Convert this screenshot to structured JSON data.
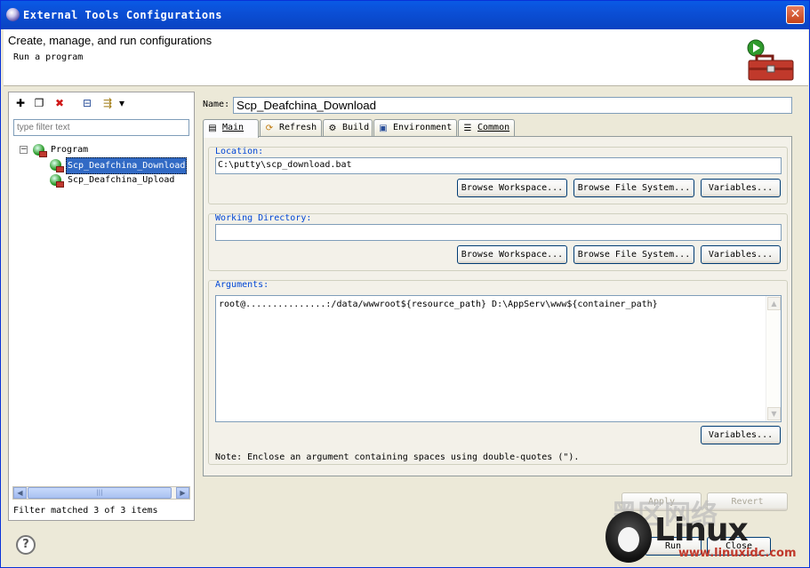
{
  "window": {
    "title": "External Tools Configurations",
    "close_label": "✕"
  },
  "header": {
    "title": "Create, manage, and run configurations",
    "subtitle": "Run a program"
  },
  "left": {
    "toolbar": [
      {
        "name": "new-configuration-icon",
        "glyph": "✚"
      },
      {
        "name": "duplicate-icon",
        "glyph": "❐"
      },
      {
        "name": "delete-icon",
        "glyph": "✖"
      },
      {
        "name": "collapse-all-icon",
        "glyph": "⊟"
      },
      {
        "name": "filter-icon",
        "glyph": "⇶"
      },
      {
        "name": "dropdown-arrow-icon",
        "glyph": "▾"
      }
    ],
    "filter_placeholder": "type filter text",
    "tree": {
      "category": "Program",
      "expander": "−",
      "items": [
        "Scp_Deafchina_Download",
        "Scp_Deafchina_Upload"
      ]
    },
    "scroll_left": "◀",
    "scroll_right": "▶",
    "scroll_grip": "|||",
    "status": "Filter matched 3 of 3 items"
  },
  "right": {
    "name_label": "Name:",
    "name_value": "Scp_Deafchina_Download",
    "tabs": [
      {
        "label": "Main",
        "icon": "main-tab-icon",
        "glyph": "▤"
      },
      {
        "label": "Refresh",
        "icon": "refresh-tab-icon",
        "glyph": "⟳"
      },
      {
        "label": "Build",
        "icon": "build-tab-icon",
        "glyph": "⚙"
      },
      {
        "label": "Environment",
        "icon": "environment-tab-icon",
        "glyph": "▣"
      },
      {
        "label": "Common",
        "icon": "common-tab-icon",
        "glyph": "☰"
      }
    ],
    "location": {
      "title": "Location:",
      "value": "C:\\putty\\scp_download.bat",
      "browse_workspace": "Browse Workspace...",
      "browse_fs": "Browse File System...",
      "variables": "Variables..."
    },
    "working_dir": {
      "title": "Working Directory:",
      "value": "",
      "browse_workspace": "Browse Workspace...",
      "browse_fs": "Browse File System...",
      "variables": "Variables..."
    },
    "arguments": {
      "title": "Arguments:",
      "value": "root@...............:/data/wwwroot${resource_path} D:\\AppServ\\www${container_path}",
      "variables": "Variables...",
      "note": "Note: Enclose an argument containing spaces using double-quotes (\")."
    },
    "scroll_up": "▲",
    "scroll_down": "▼",
    "apply": "Apply",
    "revert": "Revert",
    "run": "Run",
    "close": "Close"
  },
  "help": "?",
  "watermark": {
    "brand": "Linux",
    "cn": "黑区网络",
    "url": "www.linuxidc.com"
  }
}
